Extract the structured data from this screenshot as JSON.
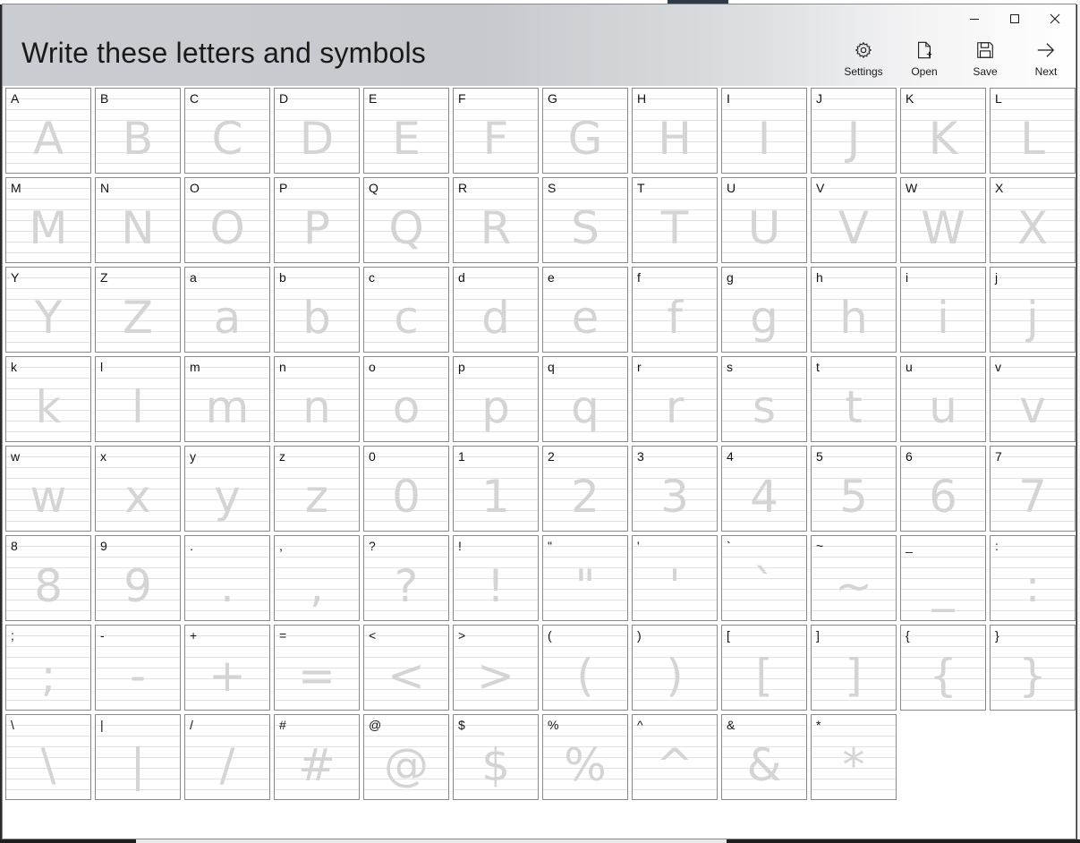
{
  "window": {
    "title": "Write these letters and symbols"
  },
  "toolbar": {
    "settings_label": "Settings",
    "open_label": "Open",
    "save_label": "Save",
    "next_label": "Next"
  },
  "glyphs": [
    "A",
    "B",
    "C",
    "D",
    "E",
    "F",
    "G",
    "H",
    "I",
    "J",
    "K",
    "L",
    "M",
    "N",
    "O",
    "P",
    "Q",
    "R",
    "S",
    "T",
    "U",
    "V",
    "W",
    "X",
    "Y",
    "Z",
    "a",
    "b",
    "c",
    "d",
    "e",
    "f",
    "g",
    "h",
    "i",
    "j",
    "k",
    "l",
    "m",
    "n",
    "o",
    "p",
    "q",
    "r",
    "s",
    "t",
    "u",
    "v",
    "w",
    "x",
    "y",
    "z",
    "0",
    "1",
    "2",
    "3",
    "4",
    "5",
    "6",
    "7",
    "8",
    "9",
    ".",
    ",",
    "?",
    "!",
    "\"",
    "'",
    "`",
    "~",
    "_",
    ":",
    ";",
    "-",
    "+",
    "=",
    "<",
    ">",
    "(",
    ")",
    "[",
    "]",
    "{",
    "}",
    "\\",
    "|",
    "/",
    "#",
    "@",
    "$",
    "%",
    "^",
    "&",
    "*"
  ],
  "icons": {
    "minimize": "minimize-icon",
    "maximize": "maximize-icon",
    "close": "close-icon",
    "settings": "gear-icon",
    "open": "document-icon",
    "save": "floppy-disk-icon",
    "next": "arrow-right-icon"
  },
  "colors": {
    "ghost_glyph": "#d4d4d4",
    "guide_line": "#e2e2e2",
    "cell_border": "#8a8a8a"
  }
}
